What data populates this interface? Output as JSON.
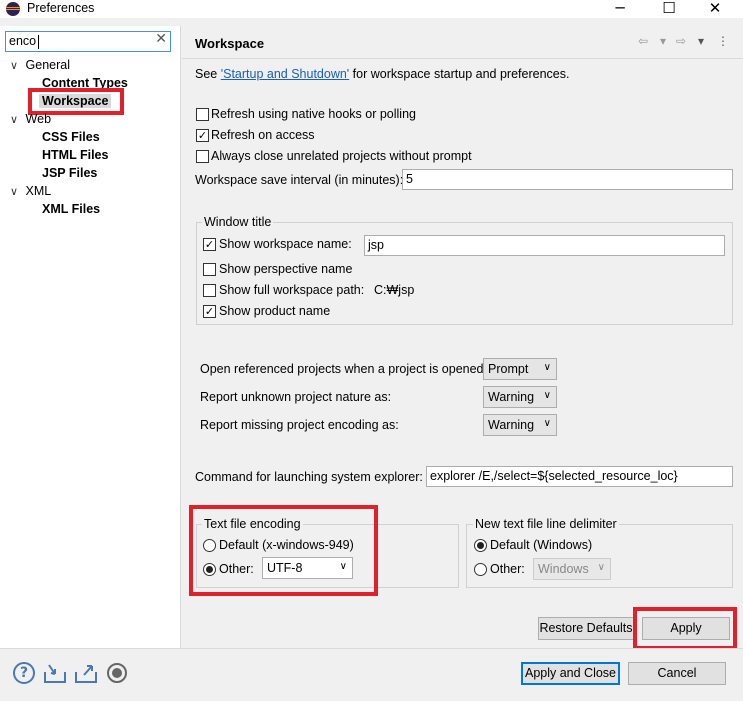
{
  "window": {
    "title": "Preferences",
    "minimize": "─",
    "maximize": "☐",
    "close": "✕"
  },
  "filter": {
    "value": "enco",
    "clear": "✕"
  },
  "tree": {
    "general": {
      "arrow": "∨",
      "label": "General"
    },
    "content_types": "Content Types",
    "workspace": "Workspace",
    "web": {
      "arrow": "∨",
      "label": "Web"
    },
    "css_files": "CSS Files",
    "html_files": "HTML Files",
    "jsp_files": "JSP Files",
    "xml": {
      "arrow": "∨",
      "label": "XML"
    },
    "xml_files": "XML Files"
  },
  "page": {
    "title": "Workspace",
    "nav": {
      "back": "⇦",
      "back_menu": "▾",
      "forward": "⇨",
      "forward_menu": "▾",
      "more": "⋮"
    },
    "intro": {
      "prefix": "See ",
      "link": "'Startup and Shutdown'",
      "suffix": " for workspace startup and preferences."
    },
    "refresh_native": {
      "label": "Refresh using native hooks or polling",
      "checked": false
    },
    "refresh_access": {
      "label": "Refresh on access",
      "checked": true
    },
    "always_close": {
      "label": "Always close unrelated projects without prompt",
      "checked": false
    },
    "save_interval": {
      "label": "Workspace save interval (in minutes):",
      "value": "5"
    },
    "window_title": {
      "title": "Window title",
      "show_workspace_name": {
        "label": "Show workspace name:",
        "checked": true,
        "value": "jsp"
      },
      "show_perspective": {
        "label": "Show perspective name",
        "checked": false
      },
      "show_full_path": {
        "label": "Show full workspace path:",
        "checked": false,
        "value": "C:₩jsp"
      },
      "show_product": {
        "label": "Show product name",
        "checked": true
      }
    },
    "open_referenced": {
      "label": "Open referenced projects when a project is opened:",
      "value": "Prompt"
    },
    "report_unknown": {
      "label": "Report unknown project nature as:",
      "value": "Warning"
    },
    "report_missing": {
      "label": "Report missing project encoding as:",
      "value": "Warning"
    },
    "explorer_cmd": {
      "label": "Command for launching system explorer:",
      "value": "explorer /E,/select=${selected_resource_loc}"
    },
    "encoding": {
      "title": "Text file encoding",
      "default_label": "Default (x-windows-949)",
      "other_label": "Other:",
      "other_value": "UTF-8",
      "selected": "other"
    },
    "line_delimiter": {
      "title": "New text file line delimiter",
      "default_label": "Default (Windows)",
      "other_label": "Other:",
      "other_value": "Windows",
      "selected": "default"
    },
    "restore_defaults": "Restore Defaults",
    "apply": "Apply"
  },
  "footer": {
    "help_icon": "?",
    "apply_and_close": "Apply and Close",
    "cancel": "Cancel"
  },
  "colors": {
    "highlight": "#e0202a",
    "link": "#1a5fb4",
    "focus": "#0078d7"
  }
}
